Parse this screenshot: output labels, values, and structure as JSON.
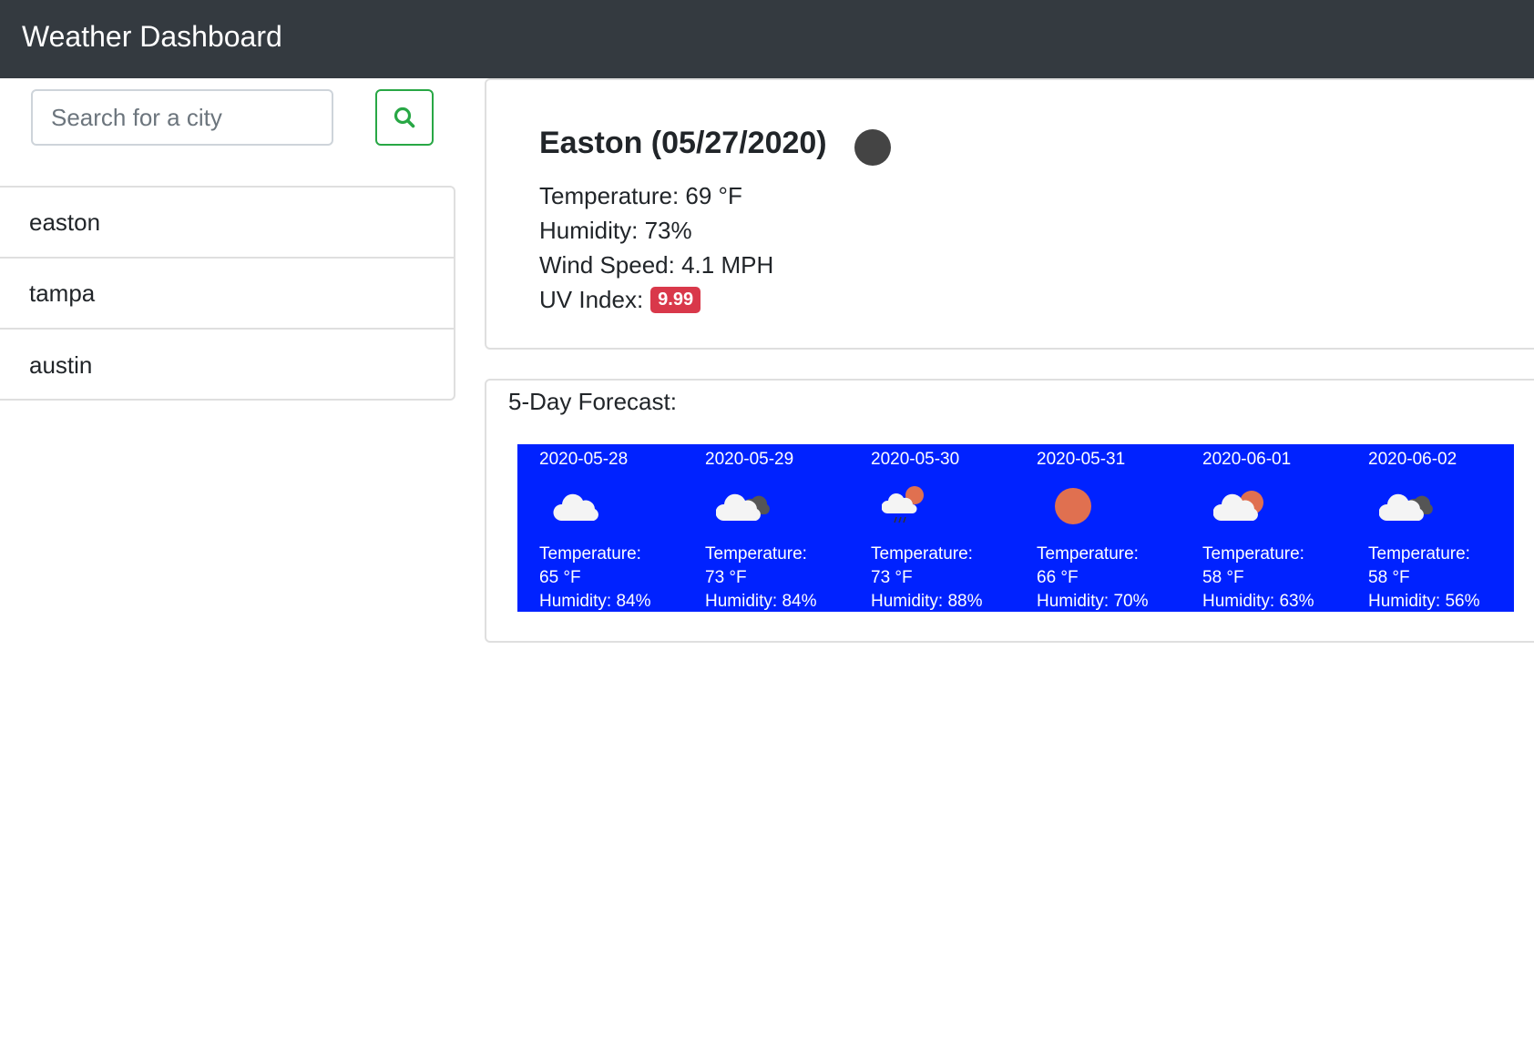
{
  "navbar": {
    "title": "Weather Dashboard"
  },
  "search": {
    "placeholder": "Search for a city",
    "button_icon": "search-icon",
    "accent": "#28a745"
  },
  "history": [
    "easton",
    "tampa",
    "austin"
  ],
  "current": {
    "title": "Easton (05/27/2020)",
    "icon": "night-dot-icon",
    "temperature": "Temperature: 69 °F",
    "humidity": "Humidity: 73%",
    "wind": "Wind Speed: 4.1 MPH",
    "uv_label": "UV Index:",
    "uv_value": "9.99",
    "uv_color": "#d9384a"
  },
  "forecast": {
    "heading": "5-Day Forecast:",
    "background": "#0022ff",
    "days": [
      {
        "date": "2020-05-28",
        "icon": "cloud-icon",
        "temp_label": "Temperature:",
        "temp": "65 °F",
        "humidity": "Humidity: 84%"
      },
      {
        "date": "2020-05-29",
        "icon": "broken-clouds-icon",
        "temp_label": "Temperature:",
        "temp": "73 °F",
        "humidity": "Humidity: 84%"
      },
      {
        "date": "2020-05-30",
        "icon": "sun-rain-icon",
        "temp_label": "Temperature:",
        "temp": "73 °F",
        "humidity": "Humidity: 88%"
      },
      {
        "date": "2020-05-31",
        "icon": "sun-icon",
        "temp_label": "Temperature:",
        "temp": "66 °F",
        "humidity": "Humidity: 70%"
      },
      {
        "date": "2020-06-01",
        "icon": "sun-cloud-icon",
        "temp_label": "Temperature:",
        "temp": "58 °F",
        "humidity": "Humidity: 63%"
      },
      {
        "date": "2020-06-02",
        "icon": "broken-clouds-icon",
        "temp_label": "Temperature:",
        "temp": "58 °F",
        "humidity": "Humidity: 56%"
      }
    ]
  }
}
